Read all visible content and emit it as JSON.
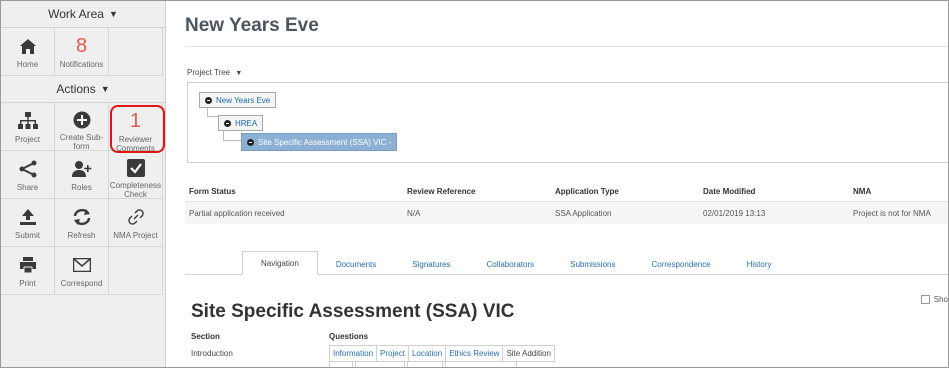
{
  "sidebar": {
    "work_area_label": "Work Area",
    "actions_label": "Actions",
    "work_tiles": [
      {
        "label": "Home",
        "icon": "home-icon"
      },
      {
        "label": "Notifications",
        "count": "8"
      }
    ],
    "action_tiles": [
      {
        "label": "Project",
        "icon": "sitemap-icon"
      },
      {
        "label": "Create Sub-form",
        "icon": "plus-circle-icon"
      },
      {
        "label": "Reviewer Comments",
        "count": "1"
      },
      {
        "label": "Share",
        "icon": "share-icon"
      },
      {
        "label": "Roles",
        "icon": "add-user-icon"
      },
      {
        "label": "Completeness Check",
        "icon": "checkbox-icon"
      },
      {
        "label": "Submit",
        "icon": "upload-icon"
      },
      {
        "label": "Refresh",
        "icon": "refresh-icon"
      },
      {
        "label": "NMA Project",
        "icon": "link-icon"
      },
      {
        "label": "Print",
        "icon": "print-icon"
      },
      {
        "label": "Correspond",
        "icon": "envelope-icon"
      }
    ]
  },
  "main": {
    "title": "New Years Eve",
    "project_tree_label": "Project Tree",
    "tree": {
      "root": "New Years Eve",
      "child": "HREA",
      "grandchild": "Site Specific Assessment (SSA) VIC -"
    },
    "status_table": {
      "headers": [
        "Form Status",
        "Review Reference",
        "Application Type",
        "Date Modified",
        "NMA"
      ],
      "row": [
        "Partial application received",
        "N/A",
        "SSA Application",
        "02/01/2019 13:13",
        "Project is not for NMA"
      ]
    },
    "tabs": [
      "Navigation",
      "Documents",
      "Signatures",
      "Collaborators",
      "Submissions",
      "Correspondence",
      "History"
    ],
    "active_tab": "Navigation",
    "show_label": "Sho",
    "form_title": "Site Specific Assessment (SSA) VIC",
    "section_header": "Section",
    "questions_header": "Questions",
    "section_value": "Introduction",
    "question_buttons": [
      "Information",
      "Project",
      "Location",
      "Ethics Review",
      "Site Addition"
    ]
  },
  "colors": {
    "notification_count": "#e35b4a",
    "link": "#2a6db5",
    "selected_node": "#8cb0d3",
    "highlight_outline": "#e01515"
  }
}
